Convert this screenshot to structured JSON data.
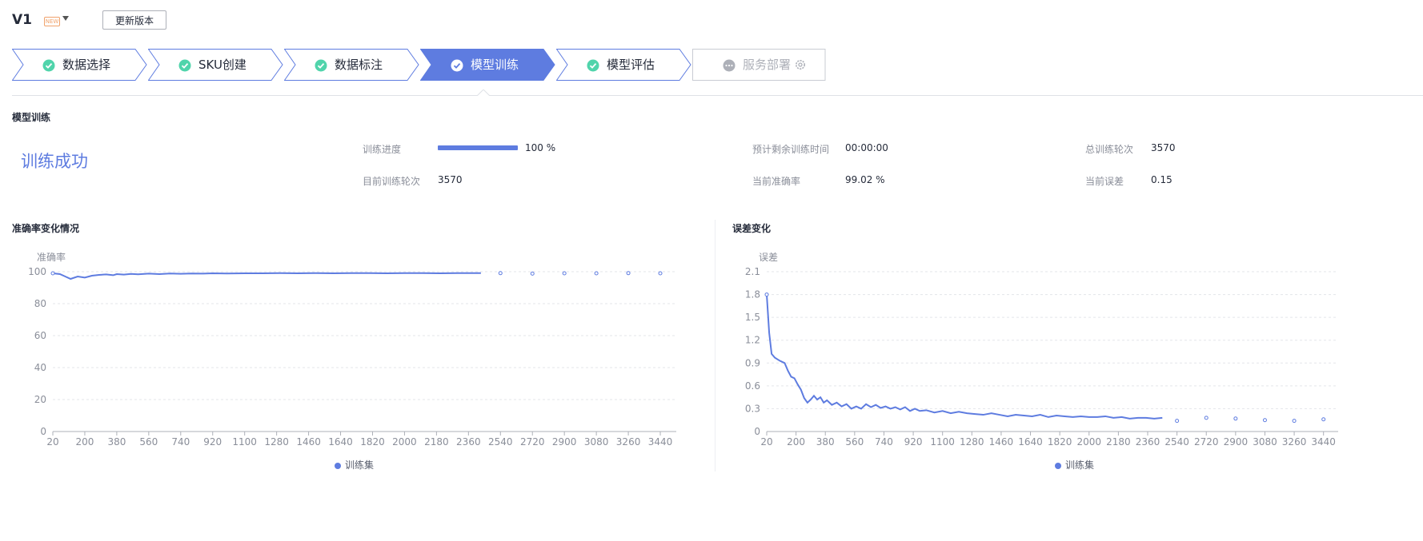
{
  "header": {
    "version": "V1",
    "new_badge": "NEW",
    "update_button": "更新版本"
  },
  "steps": [
    {
      "label": "数据选择",
      "state": "done"
    },
    {
      "label": "SKU创建",
      "state": "done"
    },
    {
      "label": "数据标注",
      "state": "done"
    },
    {
      "label": "模型训练",
      "state": "active"
    },
    {
      "label": "模型评估",
      "state": "done"
    },
    {
      "label": "服务部署",
      "state": "disabled"
    }
  ],
  "section": {
    "title": "模型训练",
    "status": "训练成功"
  },
  "stats": {
    "progress_label": "训练进度",
    "progress_value": "100 %",
    "progress_fraction": 1.0,
    "remaining_label": "预计剩余训练时间",
    "remaining_value": "00:00:00",
    "total_epochs_label": "总训练轮次",
    "total_epochs_value": "3570",
    "current_epoch_label": "目前训练轮次",
    "current_epoch_value": "3570",
    "accuracy_label": "当前准确率",
    "accuracy_value": "99.02 %",
    "loss_label": "当前误差",
    "loss_value": "0.15"
  },
  "colors": {
    "accent": "#5e7ce0",
    "success": "#50d4ab",
    "disabled": "#adb0b8"
  },
  "chart_data": [
    {
      "type": "line",
      "title": "准确率变化情况",
      "ylabel": "准确率",
      "ylim": [
        0,
        100
      ],
      "yticks": [
        0,
        20,
        40,
        60,
        80,
        100
      ],
      "xlim": [
        20,
        3530
      ],
      "xticks": [
        "20",
        "200",
        "380",
        "560",
        "740",
        "920",
        "1100",
        "1280",
        "1460",
        "1640",
        "1820",
        "2000",
        "2180",
        "2360",
        "2540",
        "2720",
        "2900",
        "3080",
        "3260",
        "3440"
      ],
      "legend": "bottom-center",
      "grid": true,
      "series": [
        {
          "name": "训练集",
          "line": {
            "x": [
              20,
              60,
              90,
              120,
              160,
              200,
              240,
              280,
              320,
              360,
              380,
              420,
              460,
              500,
              560,
              620,
              680,
              740,
              800,
              860,
              920,
              1000,
              1100,
              1200,
              1300,
              1400,
              1500,
              1600,
              1700,
              1800,
              1900,
              2000,
              2100,
              2200,
              2300,
              2400,
              2430
            ],
            "y": [
              99,
              98.5,
              97,
              95.5,
              97,
              96.3,
              97.5,
              98,
              98.3,
              97.8,
              98.5,
              98.2,
              98.6,
              98.4,
              98.8,
              98.5,
              98.9,
              98.7,
              98.9,
              98.8,
              99,
              98.9,
              99,
              99,
              99.1,
              99,
              99.1,
              99,
              99.1,
              99.1,
              99,
              99.1,
              99.1,
              99,
              99.1,
              99.1,
              99.1
            ]
          },
          "points": {
            "x": [
              2540,
              2720,
              2900,
              3080,
              3260,
              3440
            ],
            "y": [
              99.1,
              98.8,
              99,
              99,
              99.1,
              99
            ]
          }
        }
      ]
    },
    {
      "type": "line",
      "title": "误差变化",
      "ylabel": "误差",
      "ylim": [
        0,
        2.1
      ],
      "yticks": [
        0,
        0.3,
        0.6,
        0.9,
        1.2,
        1.5,
        1.8,
        2.1
      ],
      "xlim": [
        20,
        3530
      ],
      "xticks": [
        "20",
        "200",
        "380",
        "560",
        "740",
        "920",
        "1100",
        "1280",
        "1460",
        "1640",
        "1820",
        "2000",
        "2180",
        "2360",
        "2540",
        "2720",
        "2900",
        "3080",
        "3260",
        "3440"
      ],
      "legend": "bottom-center",
      "grid": true,
      "series": [
        {
          "name": "训练集",
          "line": {
            "x": [
              20,
              35,
              50,
              70,
              100,
              130,
              150,
              170,
              190,
              210,
              230,
              250,
              270,
              290,
              310,
              330,
              350,
              370,
              390,
              420,
              450,
              480,
              510,
              540,
              570,
              600,
              630,
              660,
              690,
              720,
              750,
              780,
              810,
              840,
              870,
              900,
              930,
              960,
              1000,
              1050,
              1100,
              1150,
              1200,
              1250,
              1300,
              1350,
              1400,
              1450,
              1500,
              1550,
              1600,
              1650,
              1700,
              1750,
              1800,
              1850,
              1900,
              1950,
              2000,
              2050,
              2100,
              2150,
              2200,
              2250,
              2300,
              2350,
              2400,
              2450
            ],
            "y": [
              1.8,
              1.3,
              1.02,
              0.97,
              0.93,
              0.9,
              0.8,
              0.72,
              0.7,
              0.62,
              0.55,
              0.44,
              0.38,
              0.42,
              0.47,
              0.42,
              0.45,
              0.38,
              0.41,
              0.35,
              0.38,
              0.33,
              0.36,
              0.3,
              0.33,
              0.3,
              0.36,
              0.32,
              0.35,
              0.31,
              0.33,
              0.3,
              0.32,
              0.29,
              0.32,
              0.27,
              0.3,
              0.27,
              0.28,
              0.25,
              0.27,
              0.24,
              0.26,
              0.24,
              0.23,
              0.22,
              0.24,
              0.22,
              0.2,
              0.22,
              0.21,
              0.2,
              0.22,
              0.19,
              0.21,
              0.2,
              0.19,
              0.2,
              0.19,
              0.19,
              0.2,
              0.18,
              0.19,
              0.17,
              0.18,
              0.18,
              0.17,
              0.18
            ]
          },
          "points": {
            "x": [
              2540,
              2720,
              2900,
              3080,
              3260,
              3440
            ],
            "y": [
              0.14,
              0.18,
              0.17,
              0.15,
              0.14,
              0.16
            ]
          }
        }
      ]
    }
  ]
}
